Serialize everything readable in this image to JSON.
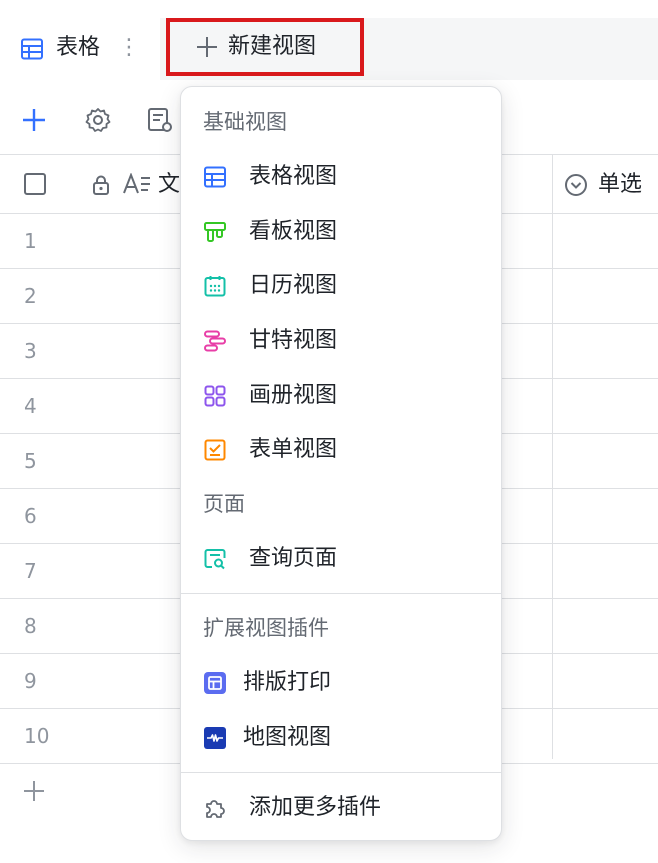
{
  "viewbar": {
    "current_view": "表格",
    "more_glyph": "⋮",
    "new_view_label": "新建视图"
  },
  "grid": {
    "text_column_label": "文",
    "single_select_label": "单选",
    "rows": [
      "1",
      "2",
      "3",
      "4",
      "5",
      "6",
      "7",
      "8",
      "9",
      "10"
    ]
  },
  "menu": {
    "basic_section": "基础视图",
    "basic_items": [
      {
        "label": "表格视图",
        "icon": "table-icon",
        "color": "#3370ff"
      },
      {
        "label": "看板视图",
        "icon": "kanban-icon",
        "color": "#34c724"
      },
      {
        "label": "日历视图",
        "icon": "calendar-icon",
        "color": "#14c0a8"
      },
      {
        "label": "甘特视图",
        "icon": "gantt-icon",
        "color": "#e83ea7"
      },
      {
        "label": "画册视图",
        "icon": "gallery-icon",
        "color": "#8d55ed"
      },
      {
        "label": "表单视图",
        "icon": "form-icon",
        "color": "#ff8800"
      }
    ],
    "page_section": "页面",
    "page_items": [
      {
        "label": "查询页面",
        "icon": "query-page-icon",
        "color": "#14c0a8"
      }
    ],
    "plugin_section": "扩展视图插件",
    "plugin_items": [
      {
        "label": "排版打印",
        "icon": "print-layout-icon",
        "color": "#5b6cf0"
      },
      {
        "label": "地图视图",
        "icon": "map-icon",
        "color": "#1a3bb3"
      }
    ],
    "more_plugins": "添加更多插件"
  },
  "colors": {
    "accent": "#3370ff",
    "highlight_border": "#d9191c",
    "divider": "#dee0e3"
  }
}
